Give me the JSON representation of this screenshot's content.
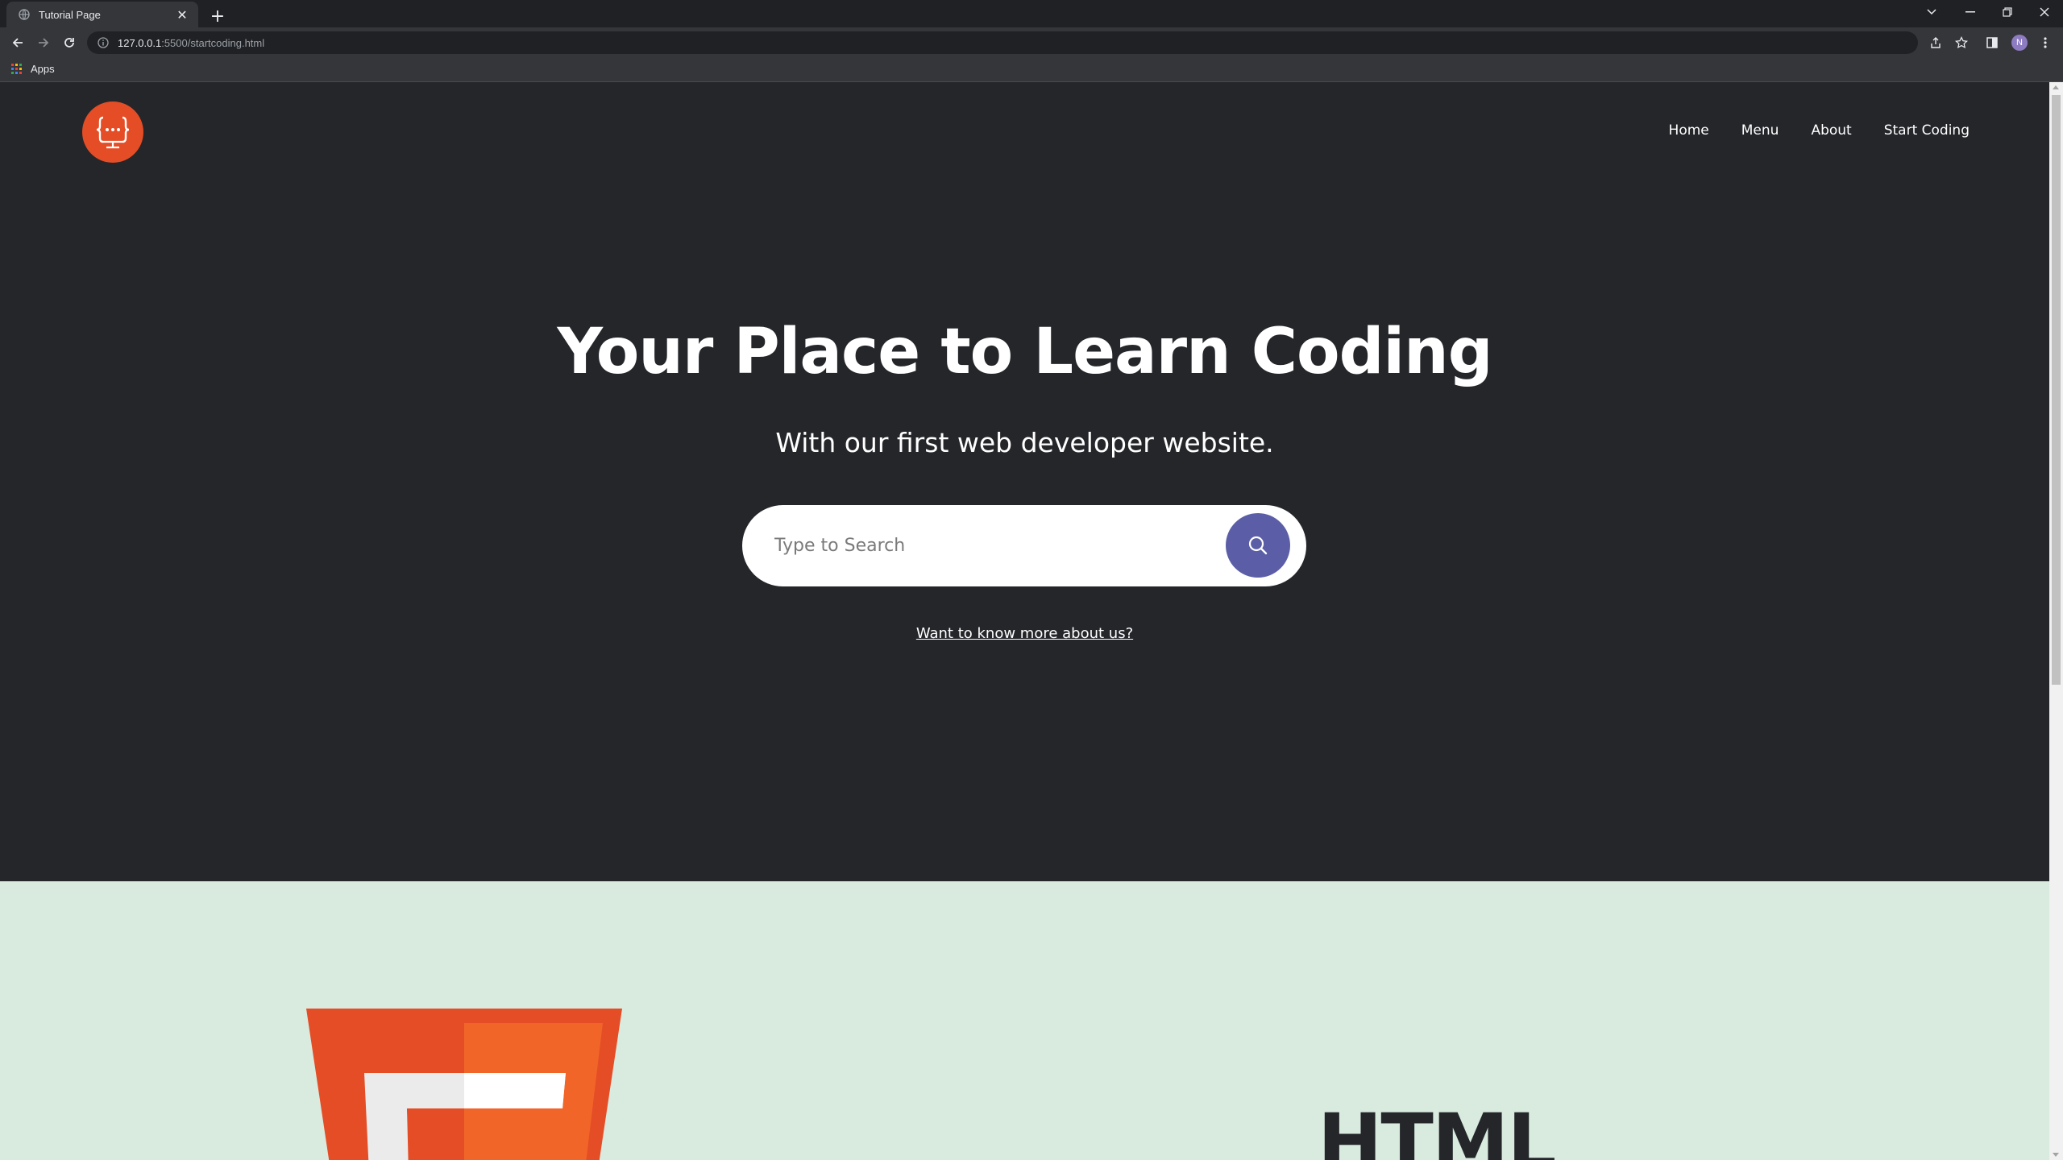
{
  "browser": {
    "tab_title": "Tutorial Page",
    "url_host": "127.0.0.1",
    "url_rest": ":5500/startcoding.html",
    "bookmarks": {
      "apps_label": "Apps"
    },
    "profile_initial": "N"
  },
  "header": {
    "nav": [
      "Home",
      "Menu",
      "About",
      "Start Coding"
    ]
  },
  "hero": {
    "title": "Your Place to Learn Coding",
    "subtitle": "With our first web developer website.",
    "search_placeholder": "Type to Search",
    "more_link": "Want to know more about us?"
  },
  "section": {
    "title": "HTML"
  },
  "colors": {
    "hero_bg": "#24262a",
    "logo_accent": "#e44d26",
    "search_button": "#5b5ea6",
    "section_bg": "#d9eadf"
  }
}
